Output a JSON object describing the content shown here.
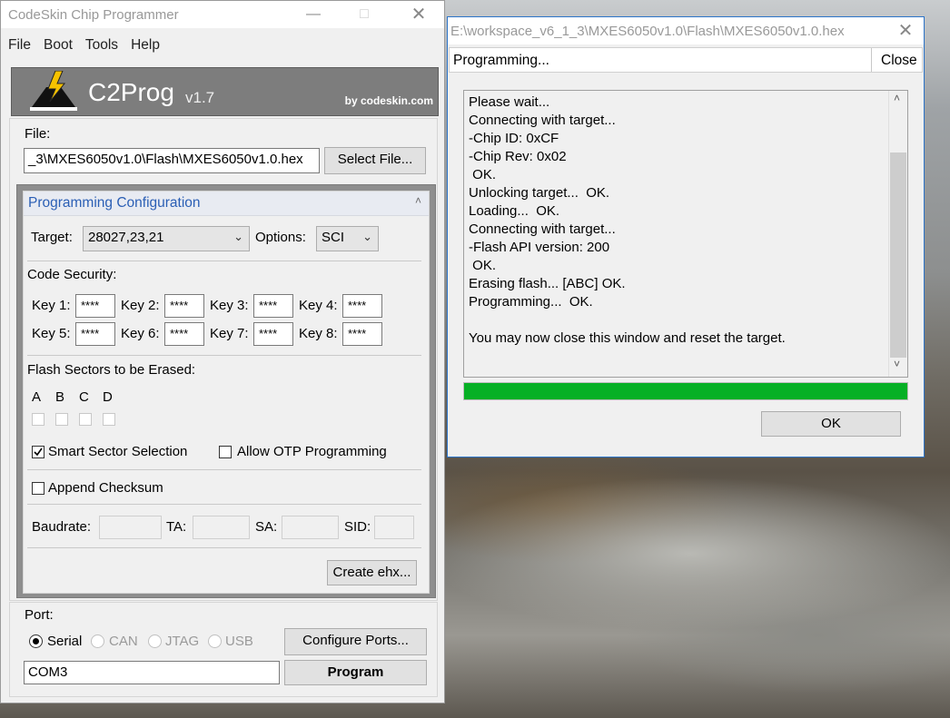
{
  "left_window": {
    "title": "CodeSkin Chip Programmer",
    "menu": [
      "File",
      "Boot",
      "Tools",
      "Help"
    ],
    "banner": {
      "app_name": "C2Prog",
      "version": "v1.7",
      "by": "by codeskin.com"
    },
    "file": {
      "label": "File:",
      "path": "_3\\MXES6050v1.0\\Flash\\MXES6050v1.0.hex",
      "select_button": "Select File..."
    },
    "config": {
      "header": "Programming Configuration",
      "target_label": "Target:",
      "target_value": "28027,23,21",
      "options_label": "Options:",
      "options_value": "SCI",
      "code_security_label": "Code Security:",
      "keys": [
        {
          "label": "Key 1:",
          "value": "****"
        },
        {
          "label": "Key 2:",
          "value": "****"
        },
        {
          "label": "Key 3:",
          "value": "****"
        },
        {
          "label": "Key 4:",
          "value": "****"
        },
        {
          "label": "Key 5:",
          "value": "****"
        },
        {
          "label": "Key 6:",
          "value": "****"
        },
        {
          "label": "Key 7:",
          "value": "****"
        },
        {
          "label": "Key 8:",
          "value": "****"
        }
      ],
      "flash_label": "Flash Sectors to be Erased:",
      "sectors": [
        "A",
        "B",
        "C",
        "D"
      ],
      "smart_sector": "Smart Sector Selection",
      "allow_otp": "Allow OTP Programming",
      "append_checksum": "Append Checksum",
      "baudrate_label": "Baudrate:",
      "ta_label": "TA:",
      "sa_label": "SA:",
      "sid_label": "SID:",
      "create_ehx": "Create ehx..."
    },
    "port": {
      "label": "Port:",
      "options": [
        "Serial",
        "CAN",
        "JTAG",
        "USB"
      ],
      "selected": "Serial",
      "configure_button": "Configure Ports...",
      "port_value": "COM3",
      "program_button": "Program"
    }
  },
  "right_window": {
    "title": "E:\\workspace_v6_1_3\\MXES6050v1.0\\Flash\\MXES6050v1.0.hex",
    "status": "Programming...",
    "close_button": "Close",
    "log": [
      "Please wait...",
      "Connecting with target...",
      "-Chip ID: 0xCF",
      "-Chip Rev: 0x02",
      " OK.",
      "Unlocking target...  OK.",
      "Loading...  OK.",
      "Connecting with target...",
      "-Flash API version: 200",
      " OK.",
      "Erasing flash... [ABC] OK.",
      "Programming...  OK.",
      "",
      "You may now close this window and reset the target."
    ],
    "progress": 1.0,
    "ok_button": "OK"
  },
  "colors": {
    "accent_blue": "#2b5fb5",
    "progress_green": "#06b025",
    "banner_gray": "#7d7d7d",
    "window_bg": "#f0f0f0"
  }
}
